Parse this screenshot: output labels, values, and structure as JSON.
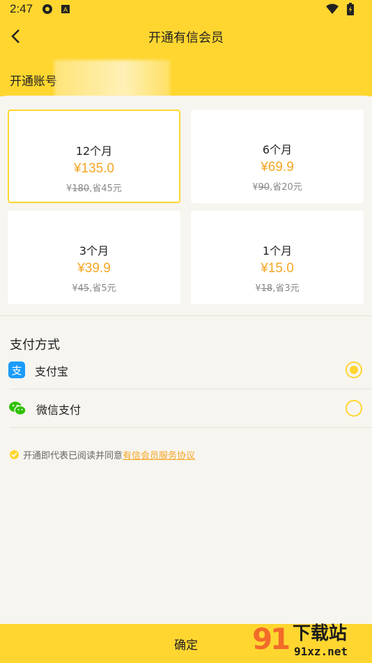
{
  "status": {
    "time": "2:47"
  },
  "header": {
    "title": "开通有信会员",
    "account_label": "开通账号"
  },
  "plans": [
    {
      "name": "12个月",
      "price": "¥135.0",
      "orig_currency": "¥",
      "orig_price": "180",
      "saving": ",省45元",
      "selected": true
    },
    {
      "name": "6个月",
      "price": "¥69.9",
      "orig_currency": "¥",
      "orig_price": "90",
      "saving": ",省20元",
      "selected": false
    },
    {
      "name": "3个月",
      "price": "¥39.9",
      "orig_currency": "¥",
      "orig_price": "45",
      "saving": ",省5元",
      "selected": false
    },
    {
      "name": "1个月",
      "price": "¥15.0",
      "orig_currency": "¥",
      "orig_price": "18",
      "saving": ",省3元",
      "selected": false
    }
  ],
  "payment": {
    "title": "支付方式",
    "methods": [
      {
        "label": "支付宝",
        "icon": "alipay-icon",
        "selected": true
      },
      {
        "label": "微信支付",
        "icon": "wechat-icon",
        "selected": false
      }
    ]
  },
  "agreement": {
    "text": "开通即代表已阅读并同意",
    "link": "有信会员服务协议"
  },
  "confirm": {
    "label": "确定"
  },
  "watermark": {
    "text": "下载站",
    "url": "91xz.net"
  },
  "colors": {
    "brand": "#ffd630",
    "price": "#f5a623",
    "alipay": "#1a9bfc",
    "wechat": "#2dc100"
  }
}
